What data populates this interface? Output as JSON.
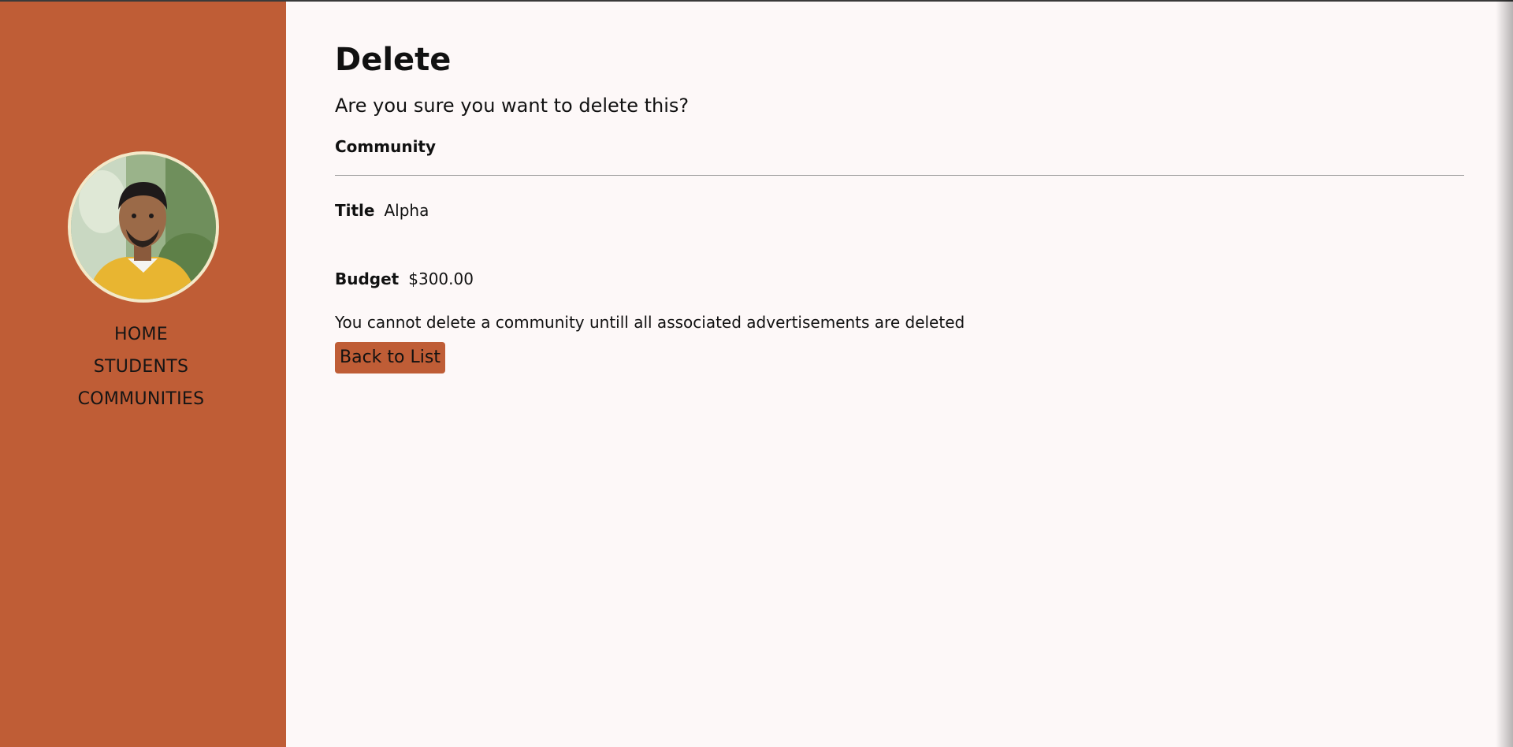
{
  "nav": {
    "items": [
      {
        "label": "HOME"
      },
      {
        "label": "STUDENTS"
      },
      {
        "label": "COMMUNITIES"
      }
    ]
  },
  "page": {
    "title": "Delete",
    "confirm_question": "Are you sure you want to delete this?",
    "entity_type": "Community",
    "fields": {
      "title_label": "Title",
      "title_value": "Alpha",
      "budget_label": "Budget",
      "budget_value": "$300.00"
    },
    "notice": "You cannot delete a community untill all associated advertisements are deleted",
    "back_button_label": "Back to List"
  },
  "colors": {
    "sidebar_bg": "#bf5d36",
    "page_bg": "#fdf8f8",
    "button_bg": "#bf5d36"
  }
}
